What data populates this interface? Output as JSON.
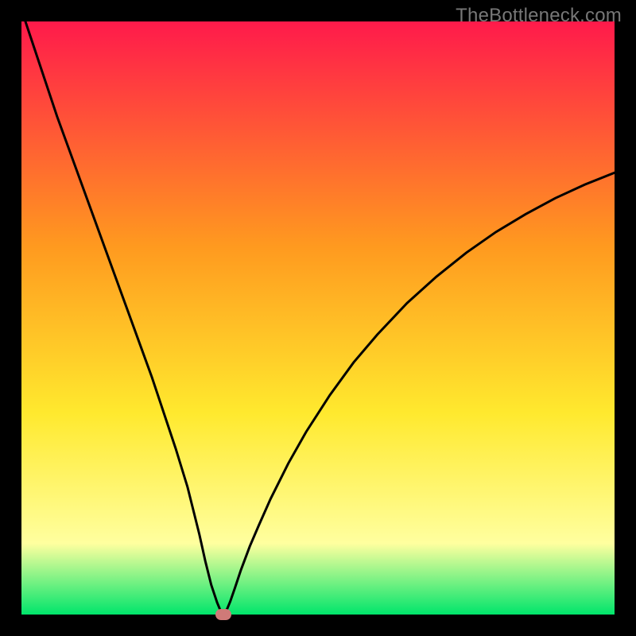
{
  "watermark": "TheBottleneck.com",
  "colors": {
    "frame": "#000000",
    "gradient_top": "#ff1a4b",
    "gradient_upper_mid": "#ff9a1f",
    "gradient_mid": "#ffe92e",
    "gradient_lower_mid": "#ffff9f",
    "gradient_bottom": "#00e56b",
    "curve": "#000000",
    "marker": "#cf7a78",
    "watermark": "#777777"
  },
  "chart_data": {
    "type": "line",
    "title": "",
    "xlabel": "",
    "ylabel": "",
    "xlim": [
      0,
      100
    ],
    "ylim": [
      0,
      100
    ],
    "grid": false,
    "legend": false,
    "annotations": [
      "TheBottleneck.com"
    ],
    "series": [
      {
        "name": "bottleneck-curve",
        "x": [
          0,
          2,
          4,
          6,
          8,
          10,
          12,
          14,
          16,
          18,
          20,
          22,
          24,
          26,
          28,
          30,
          31,
          32,
          33,
          33.5,
          33.8,
          34,
          34.3,
          34.7,
          35.2,
          36,
          37,
          38.5,
          40,
          42,
          45,
          48,
          52,
          56,
          60,
          65,
          70,
          75,
          80,
          85,
          90,
          95,
          100
        ],
        "y": [
          102,
          96,
          90,
          84,
          78.5,
          73,
          67.5,
          62,
          56.5,
          51,
          45.5,
          40,
          34,
          28,
          21.5,
          13.5,
          9,
          5,
          2,
          0.8,
          0.3,
          0.1,
          0.3,
          1,
          2.2,
          4.5,
          7.5,
          11.5,
          15,
          19.5,
          25.5,
          30.8,
          37,
          42.5,
          47.2,
          52.5,
          57,
          61,
          64.5,
          67.5,
          70.2,
          72.5,
          74.5
        ]
      }
    ],
    "marker": {
      "x": 34,
      "y": 0
    }
  }
}
